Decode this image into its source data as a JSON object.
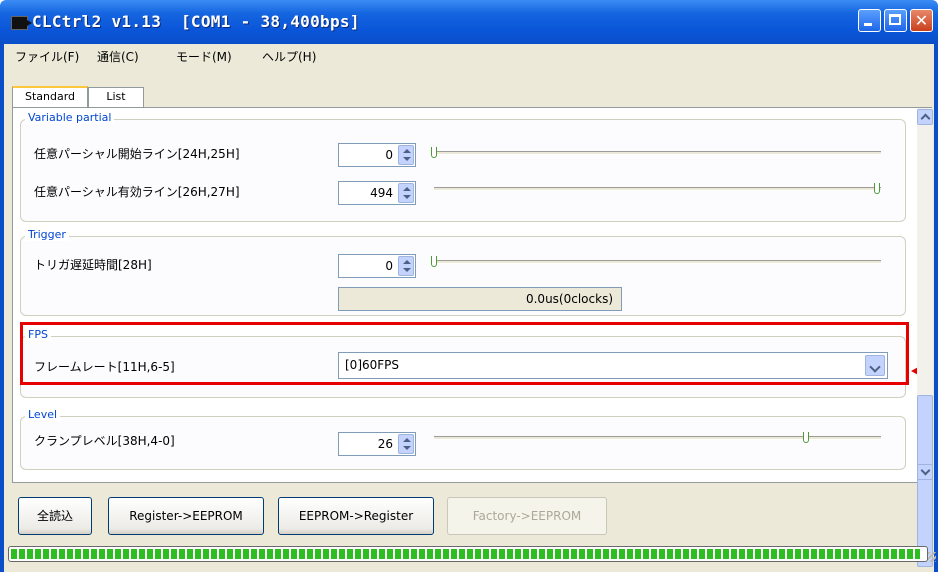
{
  "window": {
    "title": "CLCtrl2 v1.13  [COM1 - 38,400bps]"
  },
  "menu": [
    "ファイル(F)",
    "通信(C)",
    "モード(M)",
    "ヘルプ(H)"
  ],
  "tabs": [
    {
      "label": "Standard",
      "active": true
    },
    {
      "label": "List",
      "active": false
    }
  ],
  "groups": {
    "variable_partial": {
      "title": "Variable partial",
      "rows": [
        {
          "label": "任意パーシャル開始ライン[24H,25H]",
          "value": "0",
          "slider_fraction": 0.0
        },
        {
          "label": "任意パーシャル有効ライン[26H,27H]",
          "value": "494",
          "slider_fraction": 1.0
        }
      ]
    },
    "trigger": {
      "title": "Trigger",
      "row": {
        "label": "トリガ遅延時間[28H]",
        "value": "0",
        "slider_fraction": 0.0
      },
      "readout": "0.0us(0clocks)"
    },
    "fps": {
      "title": "FPS",
      "row": {
        "label": "フレームレート[11H,6-5]",
        "selected": "[0]60FPS"
      }
    },
    "level": {
      "title": "Level",
      "row": {
        "label": "クランプレベル[38H,4-0]",
        "value": "26",
        "slider_fraction": 0.83
      }
    }
  },
  "buttons": {
    "read_all": "全読込",
    "reg_to_eeprom": "Register->EEPROM",
    "eeprom_to_reg": "EEPROM->Register",
    "factory_to_eeprom": "Factory->EEPROM"
  },
  "progress": {
    "fraction": 0.995
  },
  "colors": {
    "titlebar": "#0b4fc8",
    "highlight": "#e60000",
    "group_title": "#0046d5",
    "progress": "#2ebd20"
  }
}
